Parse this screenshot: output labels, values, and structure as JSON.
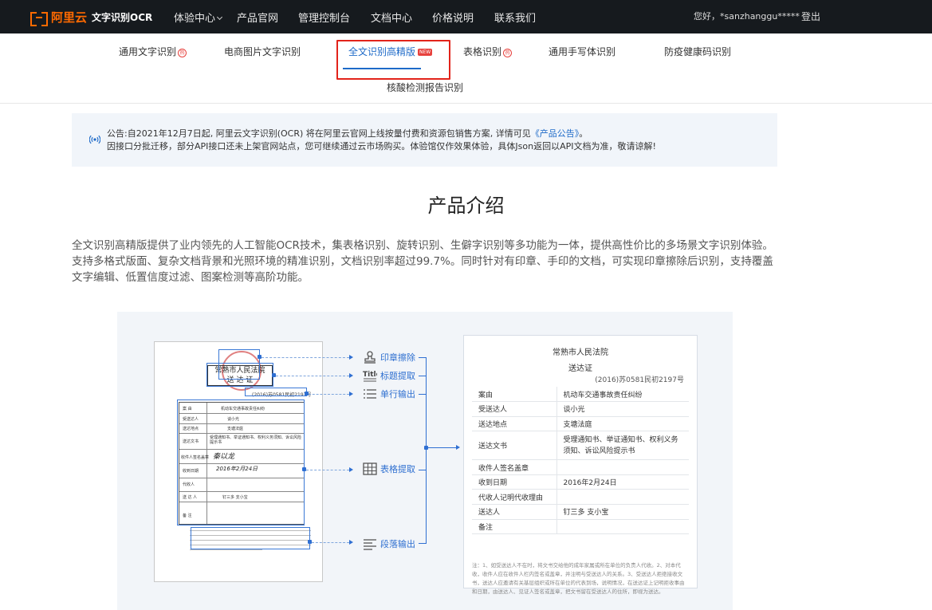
{
  "nav": {
    "brand": "阿里云",
    "product": "文字识别OCR",
    "items": [
      "体验中心",
      "产品官网",
      "管理控制台",
      "文档中心",
      "价格说明",
      "联系我们"
    ],
    "user_greeting": "您好，*sanzhanggu*****",
    "logout": "登出"
  },
  "tabs": {
    "items": [
      "通用文字识别",
      "电商图片文字识别",
      "全文识别高精版",
      "表格识别",
      "通用手写体识别",
      "防疫健康码识别"
    ],
    "row2": "核酸检测报告识别",
    "hot_label": "HOT",
    "new_label": "NEW"
  },
  "notice": {
    "line1_pre": "公告:自2021年12月7日起, 阿里云文字识别(OCR) 将在阿里云官网上线按量付费和资源包销售方案, 详情可见",
    "line1_link": "《产品公告》",
    "line1_post": "。",
    "line2": "因接口分批迁移，部分API接口还未上架官网站点，您可继续通过云市场购买。体验馆仅作效果体验，具体Json返回以API文档为准，敬请谅解!"
  },
  "intro": {
    "title": "产品介绍",
    "text": "全文识别高精版提供了业内领先的人工智能OCR技术，集表格识别、旋转识别、生僻字识别等多功能为一体，提供高性价比的多场景文字识别体验。支持多格式版面、复杂文档背景和光照环境的精准识别，文档识别率超过99.7%。同时针对有印章、手印的文档，可实现印章擦除后识别，支持覆盖文字编辑、低置信度过滤、图案检测等高阶功能。"
  },
  "diagram": {
    "source_doc": {
      "title_line1": "常熟市人民法院",
      "title_line2": "送 达 证",
      "number": "(2016)苏0581民初2197号",
      "cells": [
        "案 由",
        "机动车交通事故责任纠纷",
        "受送达人",
        "谈小光",
        "送达地点",
        "支塘法庭",
        "送达文书",
        "受理通知书、举证通知书、权利义务须知、诉讼风险提示书",
        "收件人签名盖章",
        "收到日期",
        "代收人",
        "送 达 人",
        "钉三多 支小宝",
        "备 注"
      ],
      "signature": "秦以龙",
      "date_hand": "2016年2月24日"
    },
    "features": [
      "印章擦除",
      "标题提取",
      "单行输出",
      "表格提取",
      "段落输出"
    ],
    "result": {
      "court": "常熟市人民法院",
      "doc_title": "送达证",
      "number": "(2016)苏0581民初2197号",
      "rows": [
        [
          "案由",
          "机动车交通事故责任纠纷"
        ],
        [
          "受送达人",
          "谈小光"
        ],
        [
          "送达地点",
          "支塘法庭"
        ],
        [
          "送达文书",
          "受理通知书、举证通知书、权利义务须知、诉讼风险提示书"
        ],
        [
          "收件人签名盖章",
          ""
        ],
        [
          "收到日期",
          "2016年2月24日"
        ],
        [
          "代收人记明代收理由",
          ""
        ],
        [
          "送达人",
          "钉三多 支小宝"
        ],
        [
          "备注",
          ""
        ]
      ],
      "note": "注：1、如受送达人不在时，将文书交给他的成年家属或所在单位的负责人代收。2、对本代收，收件人应在收件人栏内签名或盖章，并注明与受送达人的关系。3、受送达人拒绝接收文书，送达人应邀请有关基层组织或所在单位的代表到场，说明情况，在送达证上记明拒收事由和日期，由送达人、见证人签名或盖章，把文书留在受送达人的住所，即视为送达。"
    }
  },
  "colors": {
    "accent": "#1e6ac8",
    "brand": "#ff6a00",
    "highlight": "#e2231a",
    "nav_bg": "#161a1e"
  }
}
